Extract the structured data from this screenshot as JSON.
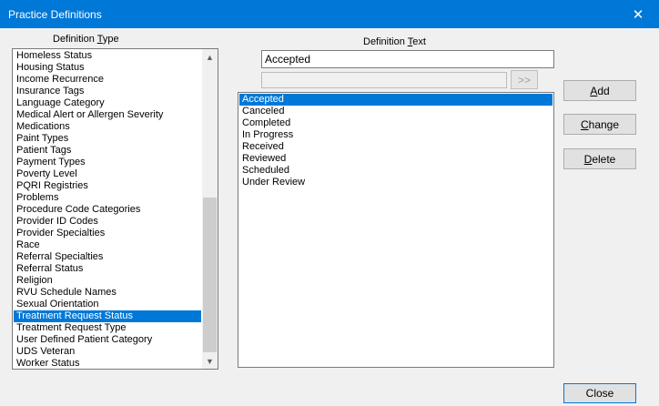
{
  "window": {
    "title": "Practice Definitions",
    "close_glyph": "✕"
  },
  "definition_type": {
    "label_prefix": "Definition ",
    "label_mnemonic": "T",
    "label_suffix": "ype",
    "items": [
      "Homeless Status",
      "Housing Status",
      "Income Recurrence",
      "Insurance Tags",
      "Language Category",
      "Medical Alert or Allergen Severity",
      "Medications",
      "Paint Types",
      "Patient Tags",
      "Payment Types",
      "Poverty Level",
      "PQRI Registries",
      "Problems",
      "Procedure Code Categories",
      "Provider ID Codes",
      "Provider Specialties",
      "Race",
      "Referral Specialties",
      "Referral Status",
      "Religion",
      "RVU Schedule Names",
      "Sexual Orientation",
      "Treatment Request Status",
      "Treatment Request Type",
      "User Defined Patient Category",
      "UDS Veteran",
      "Worker Status"
    ],
    "selected": "Treatment Request Status"
  },
  "definition_text": {
    "label_prefix": "Definition ",
    "label_mnemonic": "T",
    "label_suffix": "ext",
    "value": "Accepted",
    "secondary_value": "",
    "transfer_label": ">>",
    "items": [
      "Accepted",
      "Canceled",
      "Completed",
      "In Progress",
      "Received",
      "Reviewed",
      "Scheduled",
      "Under Review"
    ],
    "selected": "Accepted"
  },
  "buttons": {
    "add": {
      "mnemonic": "A",
      "rest": "dd"
    },
    "change": {
      "mnemonic": "C",
      "rest": "hange"
    },
    "delete": {
      "mnemonic": "D",
      "rest": "elete"
    },
    "close": "Close"
  },
  "icons": {
    "scroll_up": "scroll-up-icon",
    "scroll_down": "scroll-down-icon",
    "close": "close-icon"
  }
}
